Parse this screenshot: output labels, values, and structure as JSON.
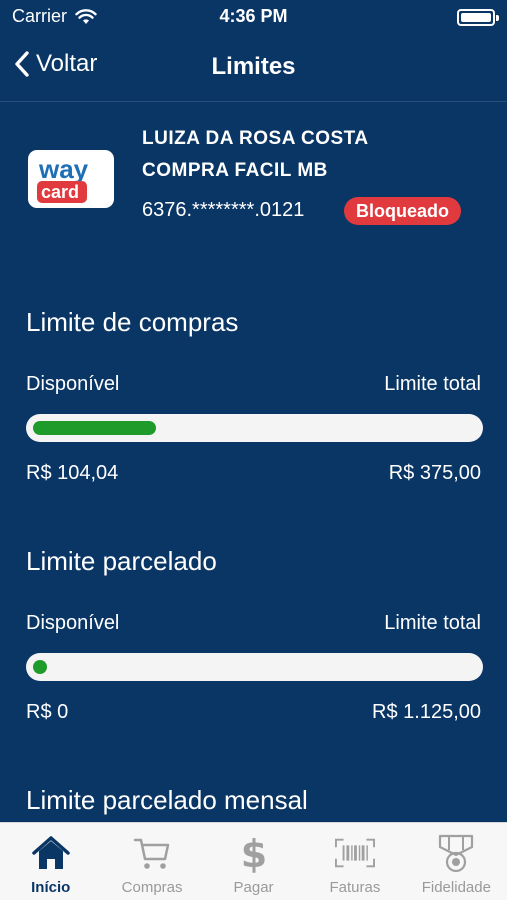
{
  "status_bar": {
    "carrier": "Carrier",
    "time": "4:36 PM"
  },
  "nav": {
    "back_label": "Voltar",
    "title": "Limites"
  },
  "card": {
    "logo_top": "way",
    "logo_bottom": "card",
    "holder_name": "LUIZA DA ROSA COSTA",
    "product": "COMPRA FACIL MB",
    "number": "6376.********.0121",
    "status": "Bloqueado",
    "status_color": "#e0393e"
  },
  "limits": [
    {
      "title": "Limite de compras",
      "available_label": "Disponível",
      "total_label": "Limite total",
      "available": "R$ 104,04",
      "total": "R$ 375,00",
      "fraction": 0.277
    },
    {
      "title": "Limite parcelado",
      "available_label": "Disponível",
      "total_label": "Limite total",
      "available": "R$ 0",
      "total": "R$ 1.125,00",
      "fraction": 0.0
    },
    {
      "title": "Limite parcelado mensal"
    }
  ],
  "tabs": [
    {
      "label": "Início",
      "icon": "home-icon",
      "active": true
    },
    {
      "label": "Compras",
      "icon": "cart-icon",
      "active": false
    },
    {
      "label": "Pagar",
      "icon": "dollar-icon",
      "active": false
    },
    {
      "label": "Faturas",
      "icon": "barcode-icon",
      "active": false
    },
    {
      "label": "Fidelidade",
      "icon": "medal-icon",
      "active": false
    }
  ],
  "colors": {
    "background": "#0a3665",
    "progress": "#1e9b2a",
    "brand_blue": "#1f6fb5",
    "brand_red": "#e0393e"
  }
}
